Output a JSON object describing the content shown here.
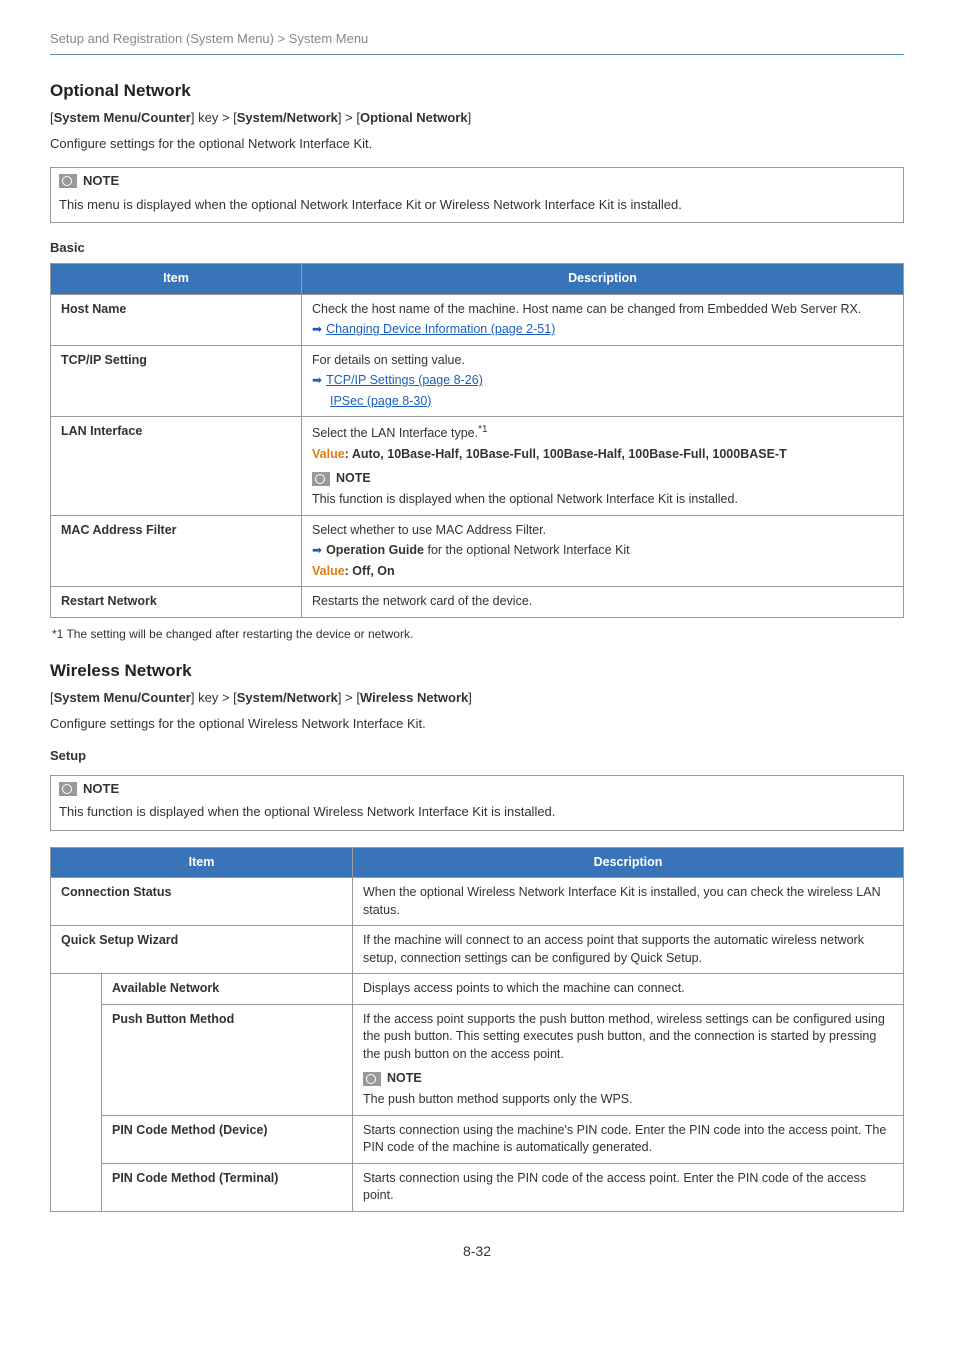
{
  "header": "Setup and Registration (System Menu) > System Menu",
  "section1": {
    "title": "Optional Network",
    "breadcrumb_prefix": "[",
    "breadcrumb_b1": "System Menu/Counter",
    "breadcrumb_mid1": "] key > [",
    "breadcrumb_b2": "System/Network",
    "breadcrumb_mid2": "] > [",
    "breadcrumb_b3": "Optional Network",
    "breadcrumb_suffix": "]",
    "desc": "Configure settings for the optional Network Interface Kit.",
    "note_label": "NOTE",
    "note_text": "This menu is displayed when the optional Network Interface Kit or Wireless Network Interface Kit is installed.",
    "basic_label": "Basic"
  },
  "table1": {
    "th1": "Item",
    "th2": "Description",
    "r1_item": "Host Name",
    "r1_line1": "Check the host name of the machine. Host name can be changed from Embedded Web Server RX.",
    "r1_link": "Changing Device Information (page 2-51)",
    "r2_item": "TCP/IP Setting",
    "r2_line1": "For details on setting value.",
    "r2_link1": "TCP/IP Settings (page 8-26)",
    "r2_link2": "IPSec (page 8-30)",
    "r3_item": "LAN Interface",
    "r3_line1_a": "Select the LAN Interface type.",
    "r3_line1_sup": "*1",
    "r3_value_label": "Value",
    "r3_value_rest": ": Auto, 10Base-Half, 10Base-Full, 100Base-Half, 100Base-Full, 1000BASE-T",
    "r3_note_label": "NOTE",
    "r3_note_text": "This function is displayed when the optional Network Interface Kit is installed.",
    "r4_item": "MAC Address Filter",
    "r4_line1": "Select whether to use MAC Address Filter.",
    "r4_guide_b": "Operation Guide",
    "r4_guide_rest": " for the optional Network Interface Kit",
    "r4_value_label": "Value",
    "r4_value_rest": ": Off, On",
    "r5_item": "Restart Network",
    "r5_line1": "Restarts the network card of the device."
  },
  "footnote": "*1   The setting will be changed after restarting the device or network.",
  "section2": {
    "title": "Wireless Network",
    "breadcrumb_prefix": "[",
    "breadcrumb_b1": "System Menu/Counter",
    "breadcrumb_mid1": "] key > [",
    "breadcrumb_b2": "System/Network",
    "breadcrumb_mid2": "] > [",
    "breadcrumb_b3": "Wireless Network",
    "breadcrumb_suffix": "]",
    "desc": "Configure settings for the optional Wireless Network Interface Kit.",
    "setup_label": "Setup",
    "note_label": "NOTE",
    "note_text": "This function is displayed when the optional Wireless Network Interface Kit is installed."
  },
  "table2": {
    "th1": "Item",
    "th2": "Description",
    "r1_item": "Connection Status",
    "r1_desc": "When the optional Wireless Network Interface Kit is installed, you can check the wireless LAN status.",
    "r2_item": "Quick Setup Wizard",
    "r2_desc": "If the machine will connect to an access point that supports the automatic wireless network setup, connection settings can be configured by Quick Setup.",
    "r3_item": "Available Network",
    "r3_desc": "Displays access points to which the machine can connect.",
    "r4_item": "Push Button Method",
    "r4_desc1": "If the access point supports the push button method, wireless settings can be configured using the push button. This setting executes push button, and the connection is started by pressing the push button on the access point.",
    "r4_note_label": "NOTE",
    "r4_desc2": "The push button method supports only the WPS.",
    "r5_item": "PIN Code Method (Device)",
    "r5_desc": "Starts connection using the machine's PIN code. Enter the PIN code into the access point. The PIN code of the machine is automatically generated.",
    "r6_item": "PIN Code Method (Terminal)",
    "r6_desc": "Starts connection using the PIN code of the access point. Enter the PIN code of the access point."
  },
  "page_number": "8-32"
}
